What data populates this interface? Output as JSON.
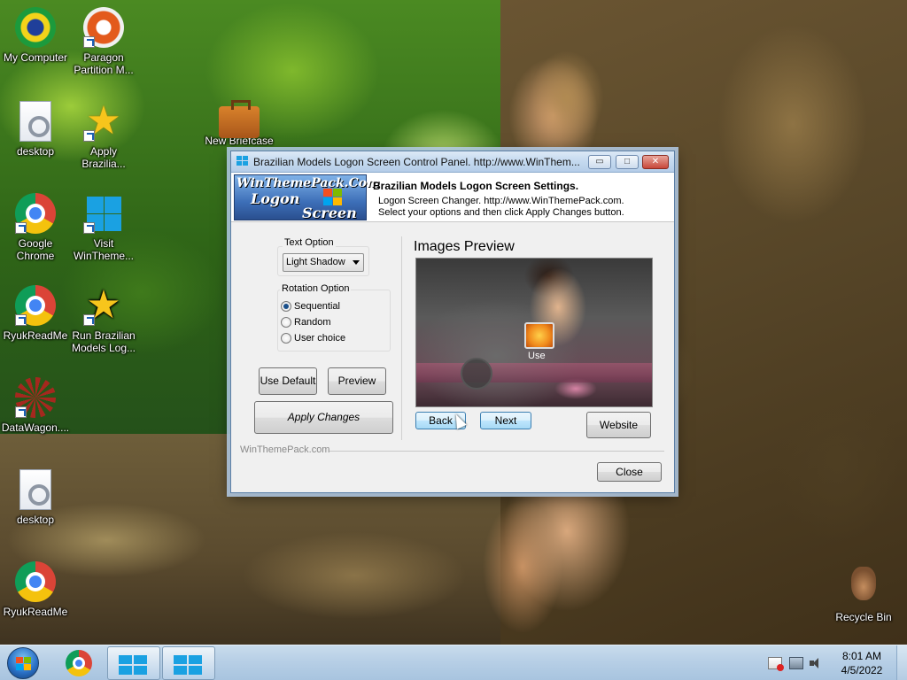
{
  "desktop": {
    "icons": [
      {
        "label": "My Computer",
        "icon": "brazil-flag-icon"
      },
      {
        "label": "Paragon Partition M...",
        "icon": "paragon-icon"
      },
      {
        "label": "desktop",
        "icon": "document-gear-icon"
      },
      {
        "label": "Apply Brazilia...",
        "icon": "star-icon"
      },
      {
        "label": "New Briefcase",
        "icon": "briefcase-icon"
      },
      {
        "label": "Google Chrome",
        "icon": "chrome-icon"
      },
      {
        "label": "Visit WinTheme...",
        "icon": "windows-logo-icon"
      },
      {
        "label": "RyukReadMe",
        "icon": "chrome-icon"
      },
      {
        "label": "Run Brazilian Models Log...",
        "icon": "star-shield-icon"
      },
      {
        "label": "DataWagon....",
        "icon": "datawagon-icon"
      },
      {
        "label": "desktop",
        "icon": "document-gear-icon"
      },
      {
        "label": "RyukReadMe",
        "icon": "chrome-icon"
      },
      {
        "label": "Recycle Bin",
        "icon": "recycle-bin-icon"
      }
    ]
  },
  "window": {
    "title": "Brazilian Models Logon Screen Control Panel. http://www.WinThem...",
    "title_buttons": {
      "minimize": "▭",
      "maximize": "□",
      "close": "✕"
    },
    "banner": {
      "logo_line1": "WinThemePack.Com",
      "logo_line2": "Logon",
      "logo_line3": "Screen",
      "heading": "Brazilian Models Logon Screen Settings.",
      "line1": "Logon Screen Changer. http://www.WinThemePack.com.",
      "line2": "Select your options and then click Apply Changes button."
    },
    "text_option": {
      "label": "Text Option",
      "selected": "Light Shadow"
    },
    "rotation_option": {
      "label": "Rotation Option",
      "options": [
        {
          "label": "Sequential",
          "checked": true
        },
        {
          "label": "Random",
          "checked": false
        },
        {
          "label": "User choice",
          "checked": false
        }
      ]
    },
    "buttons": {
      "use_default": "Use Default",
      "preview": "Preview",
      "apply_changes": "Apply Changes",
      "back": "Back",
      "next": "Next",
      "website": "Website",
      "close": "Close"
    },
    "preview": {
      "heading": "Images Preview",
      "user_text": "Use"
    },
    "footer_text": "WinThemePack.com"
  },
  "taskbar": {
    "clock_time": "8:01 AM",
    "clock_date": "4/5/2022",
    "apps": [
      "chrome-icon",
      "windows-logo-icon",
      "windows-logo-icon"
    ],
    "tray": [
      "flag-alert-icon",
      "network-icon",
      "volume-icon"
    ]
  },
  "colors": {
    "accent": "#3c7fb1",
    "window_bg": "#f0f0f0",
    "taskbar": "#b7cfe6"
  }
}
